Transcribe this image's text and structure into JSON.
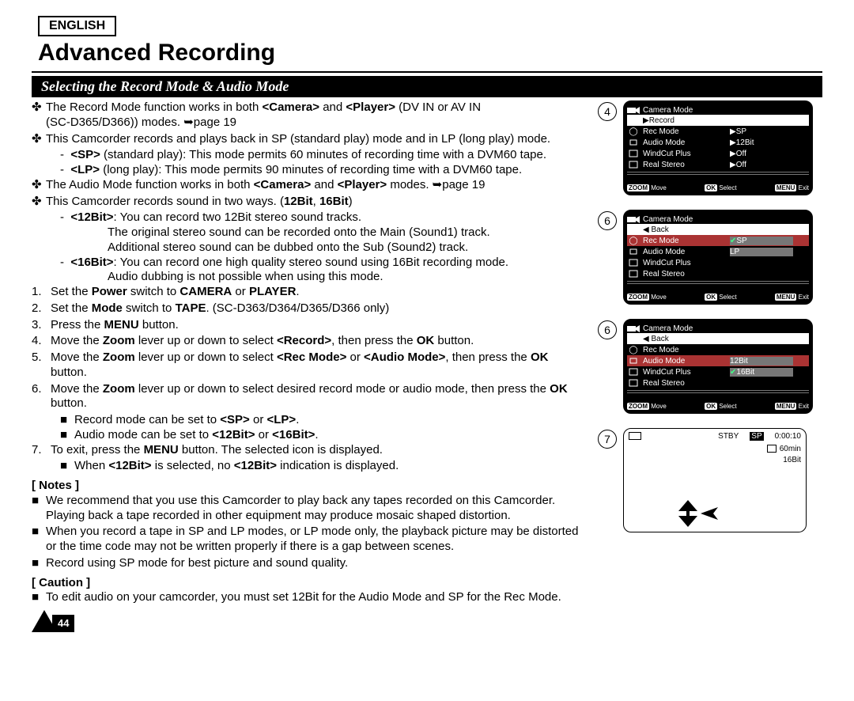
{
  "lang": "ENGLISH",
  "title": "Advanced Recording",
  "subtitle": "Selecting the Record Mode & Audio Mode",
  "bullets": {
    "b1a": "The Record Mode function works in both ",
    "b1b": " and ",
    "b1c": " (DV IN or AV IN",
    "b1_camera": "<Camera>",
    "b1_player": "<Player>",
    "b1d": "(SC-D365/D366)) modes. ➥page 19",
    "b2": "This Camcorder records and plays back in SP (standard play) mode and in LP (long play) mode.",
    "b2_sp_a": "<SP>",
    "b2_sp_b": " (standard play): This mode permits 60 minutes of recording time with a DVM60 tape.",
    "b2_lp_a": "<LP>",
    "b2_lp_b": " (long play): This mode permits 90 minutes of recording time with a DVM60 tape.",
    "b3a": "The Audio Mode function works in both ",
    "b3b": " and ",
    "b3c": " modes. ➥page 19",
    "b4a": "This Camcorder records sound in two ways. (",
    "b4_12": "12Bit",
    "b4_16": "16Bit",
    "b4b": ")",
    "b4_12hd": "<12Bit>",
    "b4_12txt": ": You can record two 12Bit stereo sound tracks.",
    "b4_12l2": "The original stereo sound can be recorded onto the Main (Sound1) track.",
    "b4_12l3": "Additional stereo sound can be dubbed onto the Sub (Sound2) track.",
    "b4_16hd": "<16Bit>",
    "b4_16txt": ": You can record one high quality stereo sound using 16Bit recording mode.",
    "b4_16l2": "Audio dubbing is not possible when using this mode."
  },
  "steps": {
    "s1": "Set the Power switch to CAMERA or PLAYER.",
    "s2": "Set the Mode switch to TAPE. (SC-D363/D364/D365/D366 only)",
    "s3": "Press the MENU button.",
    "s4": "Move the Zoom lever up or down to select <Record>, then press the OK button.",
    "s5": "Move the Zoom lever up or down to select <Rec Mode> or <Audio Mode>, then press the OK button.",
    "s6": "Move the Zoom lever up or down to select desired record mode or audio mode, then press the OK button.",
    "s6a": "Record mode can be set to <SP> or <LP>.",
    "s6b": "Audio mode can be set to <12Bit> or <16Bit>.",
    "s7": "To exit, press the MENU button. The selected icon is displayed.",
    "s7a": "When <12Bit> is selected, no <12Bit> indication is displayed."
  },
  "notes_hd": "[ Notes ]",
  "notes": {
    "n1": "We recommend that you use this Camcorder to play back any tapes recorded on this Camcorder. Playing back a tape recorded in other equipment may produce mosaic shaped distortion.",
    "n2": "When you record a tape in SP and LP modes, or LP mode only, the playback picture may be distorted or the time code may not be written properly if there is a gap between scenes.",
    "n3": "Record using SP mode for best picture and sound quality."
  },
  "caution_hd": "[ Caution ]",
  "caution": "To edit audio on your camcorder, you must set 12Bit for the Audio Mode and SP for the Rec Mode.",
  "page_number": "44",
  "screen_labels": {
    "camera_mode": "Camera Mode",
    "record": "Record",
    "back": "Back",
    "rec_mode": "Rec Mode",
    "audio_mode": "Audio Mode",
    "windcut": "WindCut Plus",
    "real_stereo": "Real Stereo",
    "sp": "SP",
    "lp": "LP",
    "b12": "12Bit",
    "b16": "16Bit",
    "off": "Off",
    "move": "Move",
    "select": "Select",
    "exit": "Exit",
    "zoom": "ZOOM",
    "ok": "OK",
    "menu": "MENU",
    "stby": "STBY",
    "time": "0:00:10",
    "remain": "60min"
  },
  "screen_nums": {
    "a": "4",
    "b": "6",
    "c": "6",
    "d": "7"
  }
}
